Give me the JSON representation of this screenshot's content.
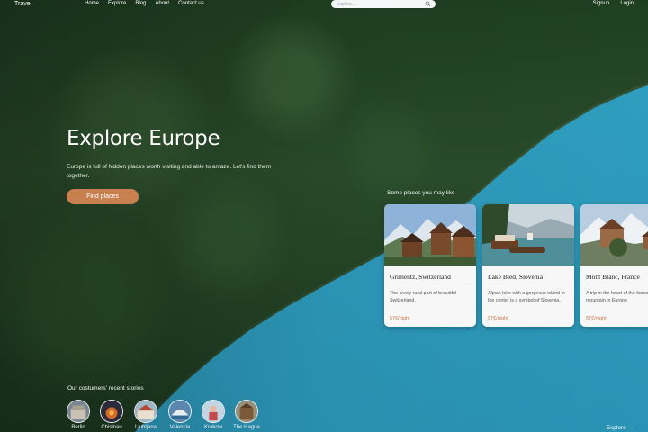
{
  "nav": {
    "brand": "Travel",
    "menu": [
      "Home",
      "Explore",
      "Blog",
      "About",
      "Contact us"
    ],
    "search_placeholder": "Explore...",
    "auth": [
      "Signup",
      "Login"
    ]
  },
  "hero": {
    "title": "Explore Europe",
    "subtitle": "Europe is full of hidden places worth visiting and able to amaze. Let's find them together.",
    "cta": "Find places"
  },
  "places": {
    "label": "Some places you may like",
    "cards": [
      {
        "title": "Grimentz, Switzerland",
        "desc": "The lovely rural part of beautiful Switzerland.",
        "price": "57€/night"
      },
      {
        "title": "Lake Bled, Slovenia",
        "desc": "Alpian lake with a gorgeous island in the center is a symbol of Slovenia.",
        "price": "57€/night"
      },
      {
        "title": "Mont Blanc, France",
        "desc": "A trip in the heart of the famous alpian mountain in Europe",
        "price": "57€/night"
      }
    ]
  },
  "stories": {
    "label": "Our costumers' recent stories",
    "items": [
      "Berlin",
      "Chisinau",
      "Ljubljana",
      "Valencia",
      "Krakow",
      "The Hague"
    ]
  },
  "footer": {
    "explore": "Explore →"
  },
  "colors": {
    "accent": "#c98050",
    "price": "#c9784a",
    "lake": "#2f9fc0",
    "forest": "#1f3f22"
  }
}
